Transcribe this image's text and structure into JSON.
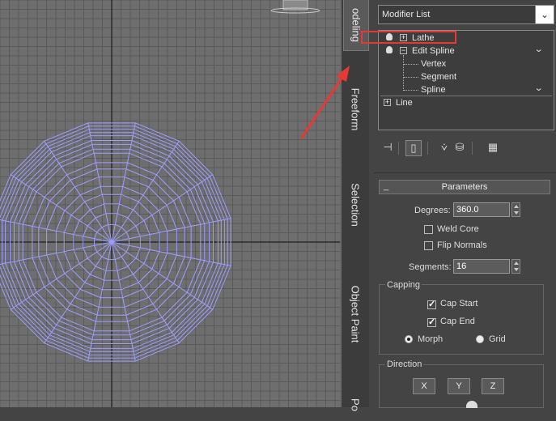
{
  "tabs": {
    "modeling": "odeling",
    "freeform": "Freeform",
    "selection": "Selection",
    "object_paint": "Object Paint",
    "populate": "Po"
  },
  "modifier_dropdown": {
    "value": "Modifier List",
    "arrow": "⌄"
  },
  "modifier_stack": {
    "lathe": "Lathe",
    "edit_spline": "Edit Spline",
    "vertex": "Vertex",
    "segment": "Segment",
    "spline": "Spline",
    "line": "Line"
  },
  "annotation": {
    "highlight_color": "#e53935",
    "arrow_color": "#e53935"
  },
  "toolbar": {
    "pin_icon": "pin-stack-icon",
    "show_end_icon": "show-end-result-icon",
    "make_unique_icon": "make-unique-icon",
    "remove_icon": "remove-modifier-icon",
    "configure_icon": "configure-modifier-sets-icon"
  },
  "parameters": {
    "title": "Parameters",
    "collapse": "_",
    "degrees_label": "Degrees:",
    "degrees_value": "360.0",
    "weld_core": "Weld Core",
    "weld_core_checked": false,
    "flip_normals": "Flip Normals",
    "flip_normals_checked": false,
    "segments_label": "Segments:",
    "segments_value": "16",
    "capping": {
      "title": "Capping",
      "cap_start": "Cap Start",
      "cap_start_checked": true,
      "cap_end": "Cap End",
      "cap_end_checked": true,
      "morph": "Morph",
      "grid": "Grid",
      "selected": "Morph"
    },
    "direction": {
      "title": "Direction",
      "x": "X",
      "y": "Y",
      "z": "Z"
    }
  },
  "colors": {
    "wireframe": "#9d9dff",
    "viewport_bg": "#6e6e6e",
    "panel_bg": "#444444"
  }
}
